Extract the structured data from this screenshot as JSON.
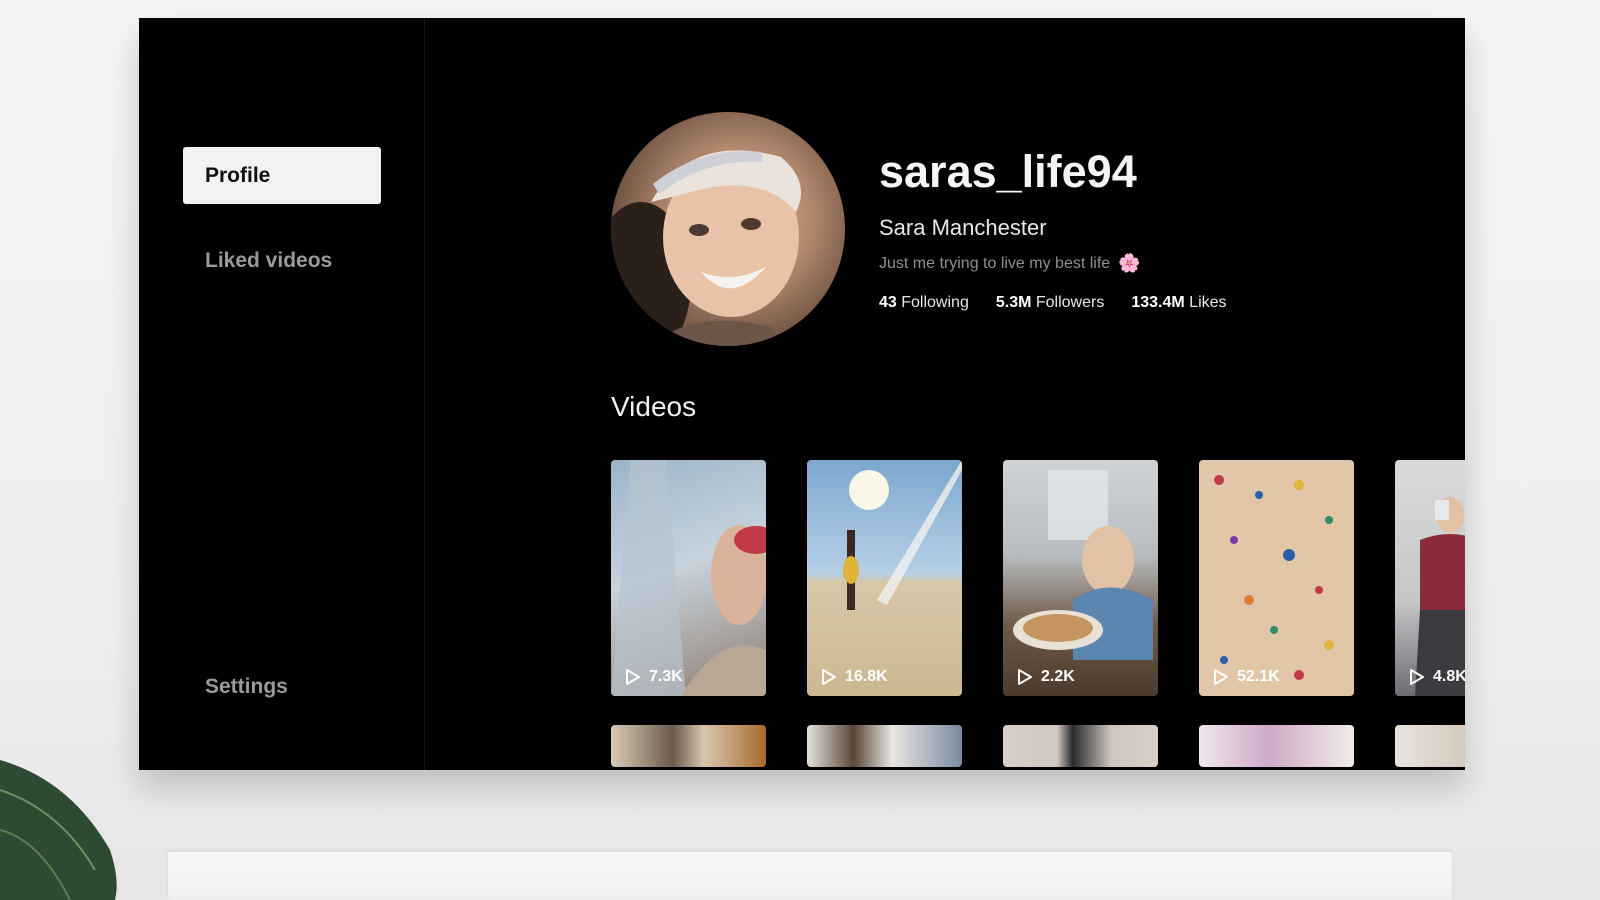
{
  "sidebar": {
    "items": [
      {
        "label": "Profile",
        "active": true
      },
      {
        "label": "Liked videos",
        "active": false
      }
    ],
    "settings_label": "Settings"
  },
  "profile": {
    "username": "saras_life94",
    "display_name": "Sara Manchester",
    "bio": "Just me trying to live my best life",
    "bio_emoji": "🌸",
    "stats": {
      "following_count": "43",
      "following_label": "Following",
      "followers_count": "5.3M",
      "followers_label": "Followers",
      "likes_count": "133.4M",
      "likes_label": "Likes"
    }
  },
  "videos": {
    "title": "Videos",
    "items": [
      {
        "views": "7.3K"
      },
      {
        "views": "16.8K"
      },
      {
        "views": "2.2K"
      },
      {
        "views": "52.1K"
      },
      {
        "views": "4.8K"
      }
    ]
  },
  "colors": {
    "background": "#000000",
    "active_nav_bg": "#f2f2f2",
    "muted_text": "#9a9a9a"
  }
}
